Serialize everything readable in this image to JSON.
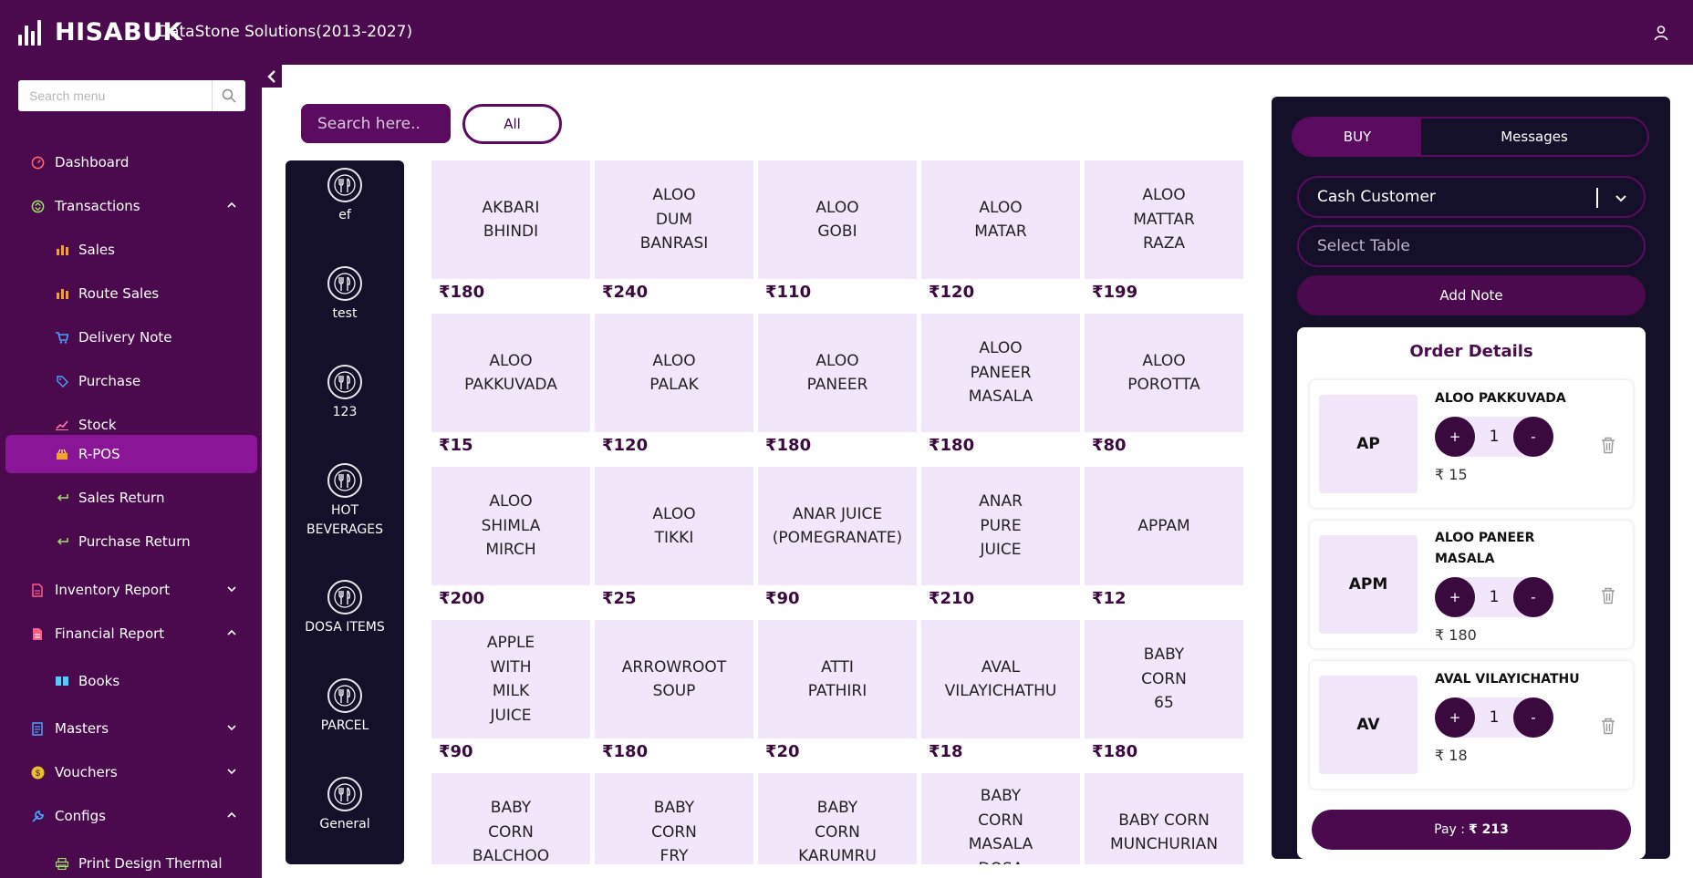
{
  "header": {
    "brand": "HISABUK",
    "company": "DataStone Solutions(2013-2027)",
    "icons": {
      "logo": "bars-chart-icon",
      "user": "user-icon"
    },
    "colors": {
      "primary": "#4a0a4d",
      "active": "#8a1596",
      "tile": "#f2e6fa",
      "dark": "#14102a"
    }
  },
  "sidebar": {
    "search_placeholder": "Search menu",
    "items": [
      {
        "label": "Dashboard",
        "icon": "gauge-icon"
      },
      {
        "label": "Transactions",
        "icon": "transactions-icon",
        "expanded": true
      },
      {
        "label": "Sales",
        "icon": "bar-chart-icon"
      },
      {
        "label": "Route Sales",
        "icon": "bar-chart-icon"
      },
      {
        "label": "Delivery Note",
        "icon": "cart-icon"
      },
      {
        "label": "Purchase",
        "icon": "tag-icon"
      },
      {
        "label": "Stock",
        "icon": "trend-icon"
      },
      {
        "label": "R-POS",
        "icon": "pos-icon",
        "active": true
      },
      {
        "label": "Sales Return",
        "icon": "return-arrow-icon"
      },
      {
        "label": "Purchase Return",
        "icon": "return-arrow-icon"
      },
      {
        "label": "Inventory Report",
        "icon": "report-icon",
        "expanded": false
      },
      {
        "label": "Financial Report",
        "icon": "report-icon",
        "expanded": true
      },
      {
        "label": "Books",
        "icon": "book-icon"
      },
      {
        "label": "Masters",
        "icon": "ledger-icon",
        "expanded": false
      },
      {
        "label": "Vouchers",
        "icon": "coin-icon",
        "expanded": false
      },
      {
        "label": "Configs",
        "icon": "wrench-icon",
        "expanded": true
      },
      {
        "label": "Print Design Thermal",
        "icon": "printer-icon"
      }
    ]
  },
  "pos": {
    "search_placeholder": "Search here..",
    "filter_label": "All",
    "categories": [
      {
        "label": "ef"
      },
      {
        "label": "test"
      },
      {
        "label": "123"
      },
      {
        "label": "HOT\nBEVERAGES"
      },
      {
        "label": "DOSA ITEMS"
      },
      {
        "label": "PARCEL"
      },
      {
        "label": "General"
      }
    ],
    "products": [
      {
        "name": "AKBARI\nBHINDI",
        "price": "₹180"
      },
      {
        "name": "ALOO\nDUM\nBANRASI",
        "price": "₹240"
      },
      {
        "name": "ALOO\nGOBI",
        "price": "₹110"
      },
      {
        "name": "ALOO\nMATAR",
        "price": "₹120"
      },
      {
        "name": "ALOO\nMATTAR\nRAZA",
        "price": "₹199"
      },
      {
        "name": "ALOO\nPAKKUVADA",
        "price": "₹15"
      },
      {
        "name": "ALOO\nPALAK",
        "price": "₹120"
      },
      {
        "name": "ALOO\nPANEER",
        "price": "₹180"
      },
      {
        "name": "ALOO\nPANEER\nMASALA",
        "price": "₹180"
      },
      {
        "name": "ALOO\nPOROTTA",
        "price": "₹80"
      },
      {
        "name": "ALOO\nSHIMLA\nMIRCH",
        "price": "₹200"
      },
      {
        "name": "ALOO\nTIKKI",
        "price": "₹25"
      },
      {
        "name": "ANAR JUICE\n(POMEGRANATE)",
        "price": "₹90"
      },
      {
        "name": "ANAR\nPURE\nJUICE",
        "price": "₹210"
      },
      {
        "name": "APPAM",
        "price": "₹12"
      },
      {
        "name": "APPLE\nWITH\nMILK\nJUICE",
        "price": "₹90"
      },
      {
        "name": "ARROWROOT\nSOUP",
        "price": "₹180"
      },
      {
        "name": "ATTI\nPATHIRI",
        "price": "₹20"
      },
      {
        "name": "AVAL\nVILAYICHATHU",
        "price": "₹18"
      },
      {
        "name": "BABY\nCORN\n65",
        "price": "₹180"
      },
      {
        "name": "BABY\nCORN\nBALCHOO",
        "price": ""
      },
      {
        "name": "BABY\nCORN\nFRY",
        "price": ""
      },
      {
        "name": "BABY\nCORN\nKARUMRU",
        "price": ""
      },
      {
        "name": "BABY\nCORN\nMASALA\nDOSA",
        "price": ""
      },
      {
        "name": "BABY CORN\nMUNCHURIAN",
        "price": ""
      }
    ]
  },
  "order_panel": {
    "tab_buy": "BUY",
    "tab_messages": "Messages",
    "customer": "Cash Customer",
    "table_placeholder": "Select Table",
    "add_note": "Add Note",
    "title": "Order Details",
    "items": [
      {
        "abbr": "AP",
        "name": "ALOO PAKKUVADA",
        "qty": "1",
        "price": "₹ 15"
      },
      {
        "abbr": "APM",
        "name": "ALOO PANEER MASALA",
        "qty": "1",
        "price": "₹ 180"
      },
      {
        "abbr": "AV",
        "name": "AVAL VILAYICHATHU",
        "qty": "1",
        "price": "₹ 18"
      }
    ],
    "plus": "+",
    "minus": "-",
    "pay_label": "Pay :",
    "pay_amount": "₹ 213"
  }
}
